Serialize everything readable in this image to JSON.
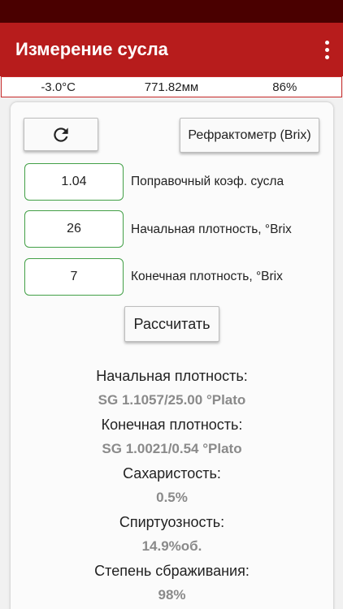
{
  "app": {
    "title": "Измерение сусла"
  },
  "info_strip": {
    "temperature": "-3.0°C",
    "pressure": "771.82мм",
    "humidity": "86%"
  },
  "toolbar": {
    "refresh_icon": "refresh-icon",
    "mode_button_label": "Рефрактометр (Brix)"
  },
  "inputs": [
    {
      "value": "1.04",
      "label": "Поправочный коэф. сусла"
    },
    {
      "value": "26",
      "label": "Начальная плотность, °Brix"
    },
    {
      "value": "7",
      "label": "Конечная плотность, °Brix"
    }
  ],
  "calculate_label": "Рассчитать",
  "results": [
    {
      "label": "Начальная плотность:",
      "value": "SG 1.1057/25.00 °Plato"
    },
    {
      "label": "Конечная плотность:",
      "value": "SG 1.0021/0.54 °Plato"
    },
    {
      "label": "Сахаристость:",
      "value": "0.5%"
    },
    {
      "label": "Спиртуозность:",
      "value": "14.9%об."
    },
    {
      "label": "Степень сбраживания:",
      "value": "98%"
    }
  ],
  "colors": {
    "app_bar": "#b71c1c",
    "status_bar": "#4a0000",
    "field_border": "#43a047",
    "result_value": "#8a8a8a"
  }
}
